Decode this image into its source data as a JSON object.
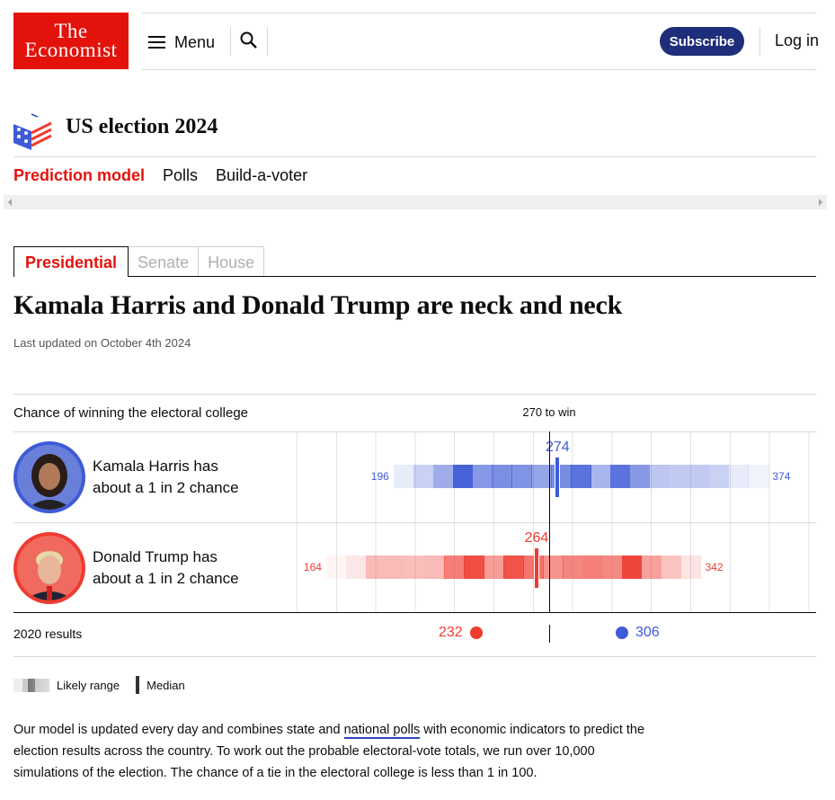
{
  "header": {
    "logo_line1": "The",
    "logo_line2": "Economist",
    "menu_label": "Menu",
    "subscribe_label": "Subscribe",
    "login_label": "Log in"
  },
  "section": {
    "title": "US election 2024",
    "nav": [
      "Prediction model",
      "Polls",
      "Build-a-voter"
    ]
  },
  "tabs": [
    "Presidential",
    "Senate",
    "House"
  ],
  "article": {
    "headline": "Kamala Harris and Donald Trump are neck and neck",
    "updated": "Last updated on October 4th 2024"
  },
  "chart": {
    "label": "Chance of winning the electoral college",
    "threshold_label": "270 to win",
    "threshold": 270,
    "candidates": [
      {
        "line1": "Kamala Harris has",
        "line2": "about a 1 in 2 chance",
        "color": "#3e5bd6",
        "min": 196,
        "max": 374,
        "median": 274,
        "min_label": "196",
        "max_label": "374",
        "median_label": "274",
        "intensity": [
          0.12,
          0.28,
          0.5,
          0.95,
          0.62,
          0.68,
          0.65,
          0.55,
          0.7,
          0.85,
          0.45,
          0.85,
          0.62,
          0.35,
          0.32,
          0.32,
          0.28,
          0.12,
          0.08
        ]
      },
      {
        "line1": "Donald Trump has",
        "line2": "about a 1 in 2 chance",
        "color": "#ef3b30",
        "min": 164,
        "max": 342,
        "median": 264,
        "min_label": "164",
        "max_label": "342",
        "median_label": "264",
        "intensity": [
          0.05,
          0.12,
          0.35,
          0.35,
          0.33,
          0.35,
          0.65,
          0.9,
          0.5,
          0.88,
          0.7,
          0.55,
          0.62,
          0.65,
          0.6,
          0.95,
          0.48,
          0.3,
          0.14
        ]
      }
    ],
    "results_label": "2020 results",
    "results_2020": {
      "trump": "232",
      "harris": "306"
    },
    "legend": {
      "range": "Likely range",
      "median": "Median"
    }
  },
  "paragraph": {
    "before": "Our model is updated every day and combines state and ",
    "link": "national polls",
    "after": " with economic indicators to predict the election results across the country. To work out the probable electoral-vote totals, we run over 10,000 simulations of the election. The chance of a tie in the electoral college is less than 1 in 100."
  }
}
